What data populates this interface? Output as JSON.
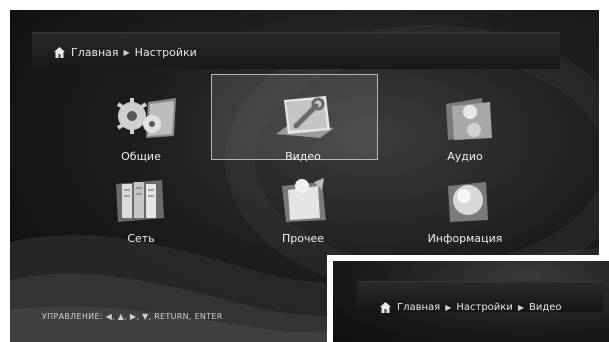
{
  "breadcrumb": {
    "home": "Главная",
    "current": "Настройки"
  },
  "menu": {
    "items": [
      {
        "label": "Общие",
        "icon": "gears-icon"
      },
      {
        "label": "Видео",
        "icon": "wrench-icon"
      },
      {
        "label": "Аудио",
        "icon": "audio-folder-icon"
      },
      {
        "label": "Сеть",
        "icon": "network-icon"
      },
      {
        "label": "Прочее",
        "icon": "misc-icon"
      },
      {
        "label": "Информация",
        "icon": "info-icon"
      }
    ],
    "selected_index": 1
  },
  "footer": {
    "controls_label": "УПРАВЛЕНИЕ:",
    "controls_keys": "◀, ▲, ▶, ▼, RETURN, ENTER"
  },
  "inset": {
    "home": "Главная",
    "level1": "Настройки",
    "level2": "Видео"
  },
  "colors": {
    "background": "#1e1e1e",
    "text": "#f0f0f0",
    "selection_border": "#b5b5b5"
  }
}
